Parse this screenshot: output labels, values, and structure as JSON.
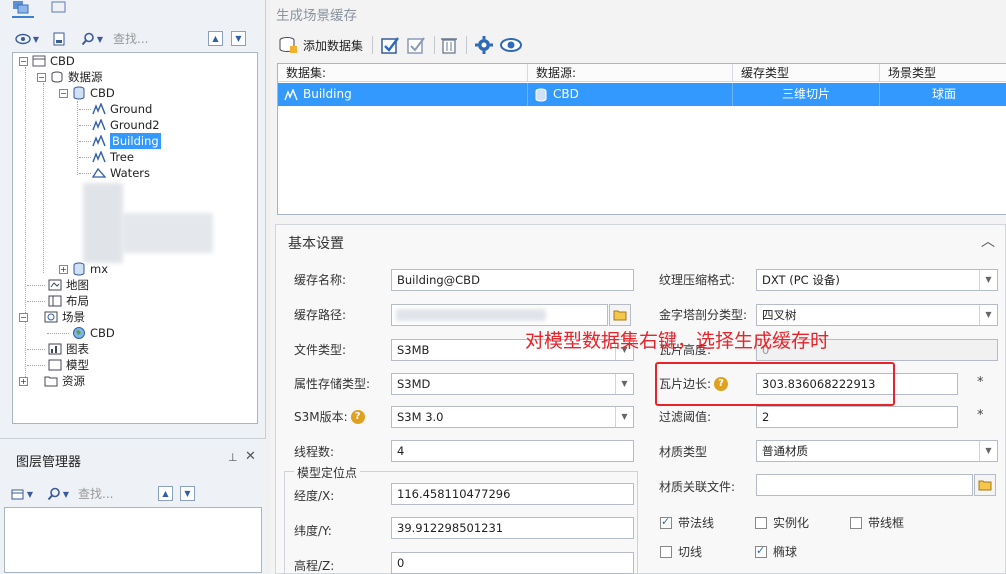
{
  "left": {
    "search_placeholder": "查找...",
    "tree": {
      "workspace": "CBD",
      "datasources": "数据源",
      "datasource_cbd": "CBD",
      "datasets": [
        "Ground",
        "Ground2",
        "Building",
        "Tree",
        "Waters"
      ],
      "selected_dataset": "Building",
      "mx": "mx",
      "maps": "地图",
      "layouts": "布局",
      "scenes": "场景",
      "scene_cbd": "CBD",
      "charts": "图表",
      "models": "模型",
      "resources": "资源"
    },
    "layer_manager": {
      "title": "图层管理器",
      "search_placeholder": "查找..."
    }
  },
  "right": {
    "title": "生成场景缓存",
    "toolbar": {
      "add_dataset": "添加数据集"
    },
    "grid": {
      "headers": [
        "数据集:",
        "数据源:",
        "缓存类型",
        "场景类型"
      ],
      "rows": [
        {
          "dataset": "Building",
          "datasource": "CBD",
          "cache_type": "三维切片",
          "scene_type": "球面"
        }
      ]
    },
    "settings": {
      "title": "基本设置",
      "cache_name_label": "缓存名称:",
      "cache_name_value": "Building@CBD",
      "cache_path_label": "缓存路径:",
      "file_type_label": "文件类型:",
      "file_type_value": "S3MB",
      "attr_storage_label": "属性存储类型:",
      "attr_storage_value": "S3MD",
      "s3m_version_label": "S3M版本:",
      "s3m_version_value": "S3M 3.0",
      "threads_label": "线程数:",
      "threads_value": "4",
      "position_group": "模型定位点",
      "lon_label": "经度/X:",
      "lon_value": "116.458110477296",
      "lat_label": "纬度/Y:",
      "lat_value": "39.912298501231",
      "elev_label": "高程/Z:",
      "elev_value": "0",
      "texture_label": "纹理压缩格式:",
      "texture_value": "DXT (PC 设备)",
      "pyramid_label": "金字塔剖分类型:",
      "pyramid_value": "四叉树",
      "tile_height_label": "瓦片高度:",
      "tile_height_value": "0",
      "tile_edge_label": "瓦片边长:",
      "tile_edge_value": "303.836068222913",
      "filter_label": "过滤阈值:",
      "filter_value": "2",
      "material_type_label": "材质类型",
      "material_type_value": "普通材质",
      "material_file_label": "材质关联文件:",
      "checkboxes": [
        {
          "label": "带法线",
          "checked": true
        },
        {
          "label": "实例化",
          "checked": false
        },
        {
          "label": "带线框",
          "checked": false
        },
        {
          "label": "切线",
          "checked": false
        },
        {
          "label": "椭球",
          "checked": true
        }
      ],
      "required_mark": "*"
    },
    "annotation": "对模型数据集右键，选择生成缓存时"
  },
  "colors": {
    "selection": "#3399ff",
    "annotation": "#e8242b"
  }
}
